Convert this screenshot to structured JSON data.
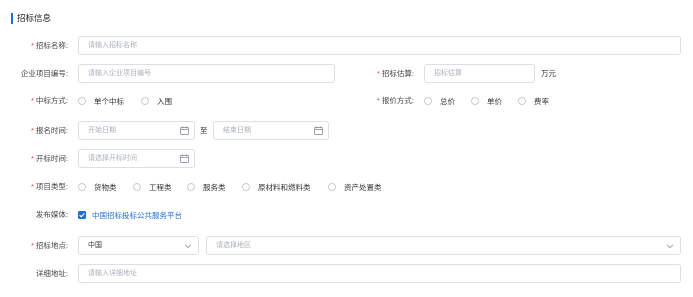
{
  "section": {
    "title": "招标信息"
  },
  "fields": {
    "project_name": {
      "label": "招标名称:",
      "placeholder": "请输入招标名称"
    },
    "enterprise_code": {
      "label": "企业项目编号:",
      "placeholder": "请输入企业项目编号"
    },
    "estimate": {
      "label": "招标估算:",
      "placeholder": "招标估算",
      "unit": "万元"
    },
    "bid_method": {
      "label": "中标方式:",
      "options": [
        "单个中标",
        "入围"
      ]
    },
    "quote_method": {
      "label": "报价方式:",
      "options": [
        "总价",
        "单价",
        "费率"
      ]
    },
    "signup_time": {
      "label": "报名时间:",
      "start_placeholder": "开始日期",
      "separator": "至",
      "end_placeholder": "结束日期"
    },
    "open_time": {
      "label": "开标时间:",
      "placeholder": "请选择开标时间"
    },
    "project_type": {
      "label": "项目类型:",
      "options": [
        "货物类",
        "工程类",
        "服务类",
        "原材料和燃料类",
        "资产处置类"
      ]
    },
    "publish_media": {
      "label": "发布媒体:",
      "checked_option": "中国招标投标公共服务平台"
    },
    "location": {
      "label": "招标地点:",
      "country": "中国",
      "region_placeholder": "请选择地区"
    },
    "address": {
      "label": "详细地址:",
      "placeholder": "请输入详细地址"
    }
  },
  "colors": {
    "accent": "#1d6fd6",
    "required": "#e23b3b",
    "border": "#dcdfe6"
  },
  "icons": {
    "date": "calendar-icon",
    "dropdown": "chevron-down-icon",
    "checkbox": "check-icon"
  }
}
